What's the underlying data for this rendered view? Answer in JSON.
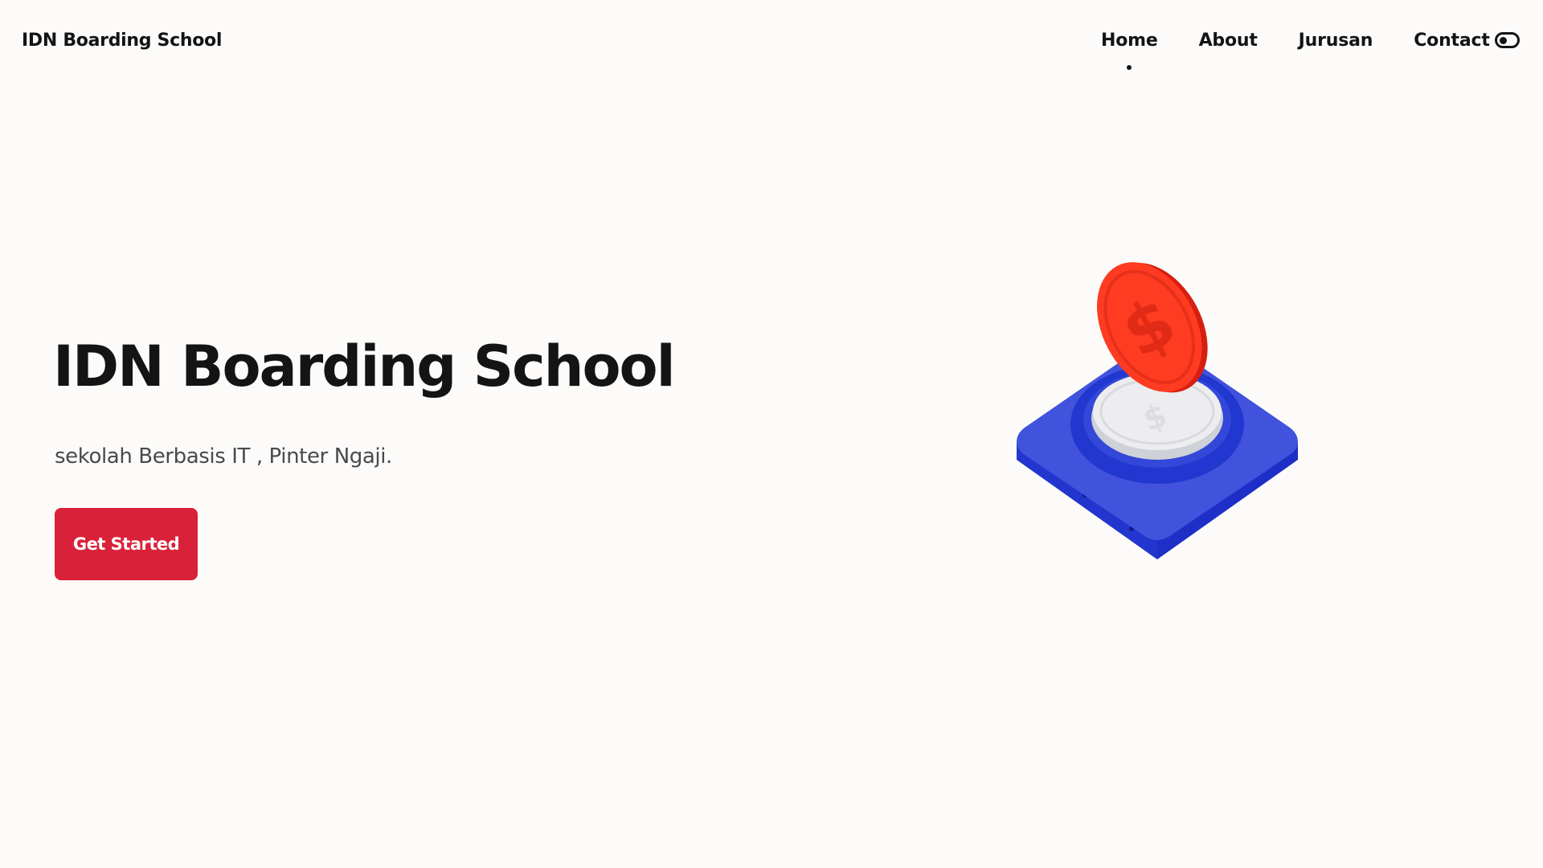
{
  "header": {
    "brand": "IDN Boarding School",
    "nav": [
      {
        "label": "Home",
        "active": true
      },
      {
        "label": "About",
        "active": false
      },
      {
        "label": "Jurusan",
        "active": false
      },
      {
        "label": "Contact",
        "active": false
      }
    ],
    "theme_toggle_icon": "toggle-switch-icon"
  },
  "hero": {
    "title": "IDN Boarding School",
    "subtitle": "sekolah Berbasis IT , Pinter Ngaji.",
    "cta_label": "Get Started",
    "illustration": "coin-button-illustration"
  },
  "colors": {
    "background": "#fcfbfa",
    "text": "#141414",
    "accent": "#d9223a",
    "illustration_blue": "#3a4fd6",
    "illustration_red": "#ff3b22"
  }
}
